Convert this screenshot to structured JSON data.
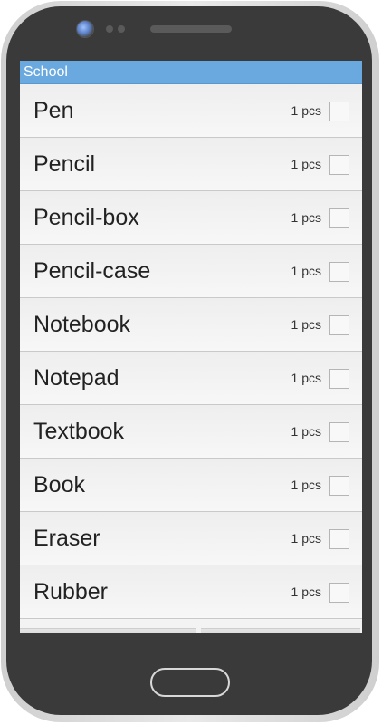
{
  "app": {
    "title": "School"
  },
  "items": [
    {
      "label": "Pen",
      "qty": "1 pcs",
      "checked": false
    },
    {
      "label": "Pencil",
      "qty": "1 pcs",
      "checked": false
    },
    {
      "label": "Pencil-box",
      "qty": "1 pcs",
      "checked": false
    },
    {
      "label": "Pencil-case",
      "qty": "1 pcs",
      "checked": false
    },
    {
      "label": "Notebook",
      "qty": "1 pcs",
      "checked": false
    },
    {
      "label": "Notepad",
      "qty": "1 pcs",
      "checked": false
    },
    {
      "label": "Textbook",
      "qty": "1 pcs",
      "checked": false
    },
    {
      "label": "Book",
      "qty": "1 pcs",
      "checked": false
    },
    {
      "label": "Eraser",
      "qty": "1 pcs",
      "checked": false
    },
    {
      "label": "Rubber",
      "qty": "1 pcs",
      "checked": false
    }
  ],
  "colors": {
    "title_bar": "#6aa8e0",
    "phone_body": "#3a3a3a"
  }
}
